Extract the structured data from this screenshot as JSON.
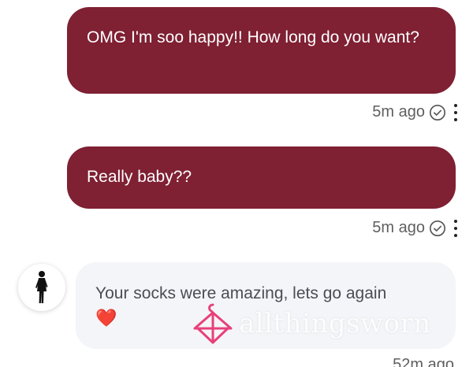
{
  "messages": [
    {
      "direction": "outgoing",
      "text": "OMG I'm soo happy!! How long do you want?",
      "time": "5m ago",
      "status_icon": "check-circle-icon"
    },
    {
      "direction": "outgoing",
      "text": "Really baby??",
      "time": "5m ago",
      "status_icon": "check-circle-icon"
    },
    {
      "direction": "incoming",
      "text": "Your socks were amazing, lets go again",
      "emoji": "❤️",
      "avatar_icon": "woman-figure-icon",
      "time": "52m ago"
    }
  ],
  "watermark": {
    "text": "allthingsworn",
    "logo": "hanger-icon"
  },
  "colors": {
    "outgoing_bubble": "#7f2033",
    "incoming_bubble": "#f4f5f8",
    "meta_text": "#5f5f5f",
    "watermark_logo": "#e8407a"
  }
}
